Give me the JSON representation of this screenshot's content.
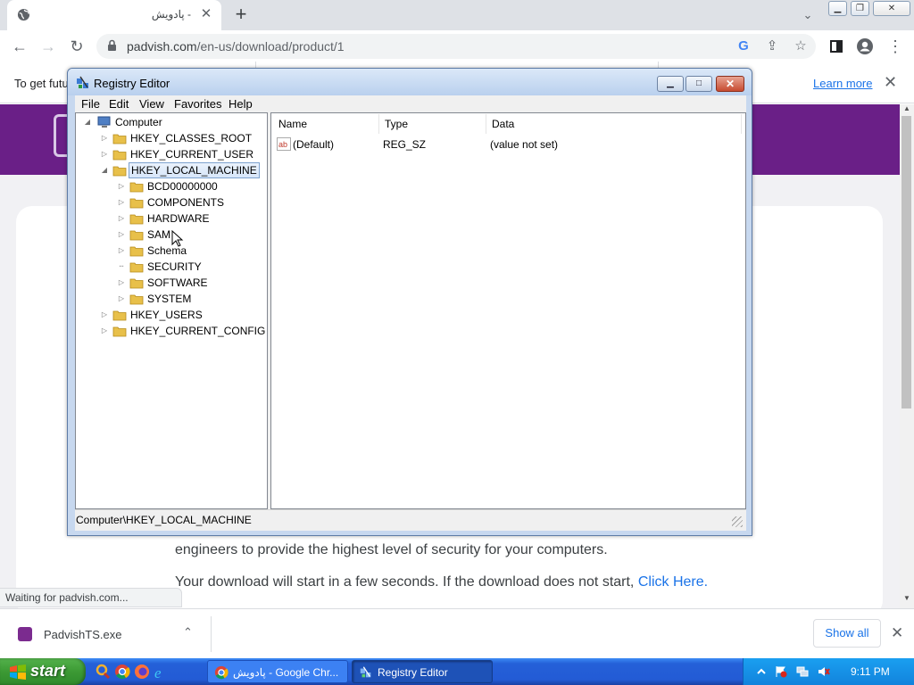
{
  "browser": {
    "tab_title": "پادویش -",
    "url_host": "padvish.com",
    "url_path": "/en-us/download/product/1",
    "infobar_message": "To get futu",
    "infobar_link": "Learn more",
    "status_text": "Waiting for padvish.com..."
  },
  "page": {
    "para1": "engineers to provide the highest level of security for your computers.",
    "para2": "Your download will start in a few seconds. If the download does not start,",
    "para2_link": "Click Here."
  },
  "download_bar": {
    "file_name": "PadvishTS.exe",
    "show_all": "Show all"
  },
  "regedit": {
    "title": "Registry Editor",
    "menu": [
      "File",
      "Edit",
      "View",
      "Favorites",
      "Help"
    ],
    "tree": {
      "root": "Computer",
      "hives": [
        "HKEY_CLASSES_ROOT",
        "HKEY_CURRENT_USER",
        "HKEY_LOCAL_MACHINE",
        "HKEY_USERS",
        "HKEY_CURRENT_CONFIG"
      ],
      "hklm_children": [
        "BCD00000000",
        "COMPONENTS",
        "HARDWARE",
        "SAM",
        "Schema",
        "SECURITY",
        "SOFTWARE",
        "SYSTEM"
      ]
    },
    "columns": [
      "Name",
      "Type",
      "Data"
    ],
    "values": [
      {
        "name": "(Default)",
        "type": "REG_SZ",
        "data": "(value not set)"
      }
    ],
    "status_path": "Computer\\HKEY_LOCAL_MACHINE"
  },
  "taskbar": {
    "start_label": "start",
    "buttons": [
      "پادویش - Google Chr...",
      "Registry Editor"
    ],
    "clock": "9:11 PM"
  },
  "colors": {
    "padvish_purple": "#6a1f87",
    "xp_taskbar": "#235bd5",
    "xp_start": "#3c9a34",
    "link_blue": "#1a73e8"
  }
}
